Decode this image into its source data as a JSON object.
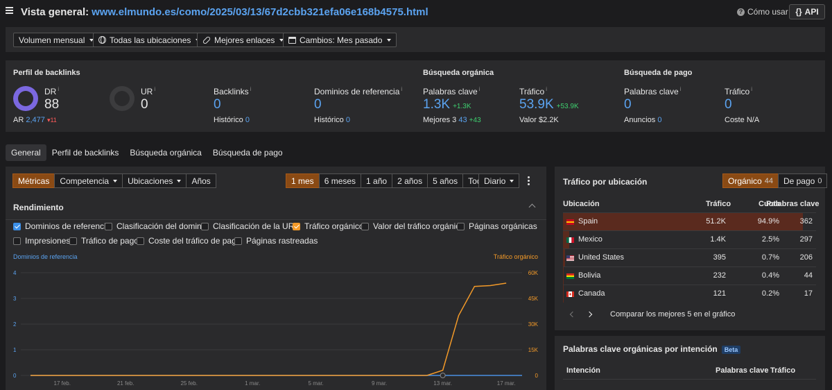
{
  "header": {
    "title": "Vista general:",
    "url": "www.elmundo.es/como/2025/03/13/67d2cbb321efa06e168b4575.html",
    "howto_label": "Cómo usar",
    "api_label": "API"
  },
  "filters": {
    "volume": "Volumen mensual",
    "locations": "Todas las ubicaciones",
    "links": "Mejores enlaces",
    "changes": "Cambios: Mes pasado"
  },
  "metrics": {
    "backlink_profile_title": "Perfil de backlinks",
    "organic_title": "Búsqueda orgánica",
    "paid_title": "Búsqueda de pago",
    "dr": {
      "label": "DR",
      "value": "88",
      "ar_label": "AR",
      "ar_value": "2,477",
      "ar_delta": "▾11"
    },
    "ur": {
      "label": "UR",
      "value": "0"
    },
    "backlinks": {
      "label": "Backlinks",
      "value": "0",
      "history_label": "Histórico",
      "history_value": "0"
    },
    "ref_domains": {
      "label": "Dominios de referencia",
      "value": "0",
      "history_label": "Histórico",
      "history_value": "0"
    },
    "organic_keywords": {
      "label": "Palabras clave",
      "value": "1.3K",
      "delta": "+1.3K",
      "top3_label": "Mejores 3",
      "top3_value": "43",
      "top3_delta": "+43"
    },
    "organic_traffic": {
      "label": "Tráfico",
      "value": "53.9K",
      "delta": "+53.9K",
      "value_label": "Valor",
      "value_amount": "$2.2K"
    },
    "paid_keywords": {
      "label": "Palabras clave",
      "value": "0",
      "ads_label": "Anuncios",
      "ads_value": "0"
    },
    "paid_traffic": {
      "label": "Tráfico",
      "value": "0",
      "cost_label": "Coste",
      "cost_value": "N/A"
    }
  },
  "tabs": [
    "General",
    "Perfil de backlinks",
    "Búsqueda orgánica",
    "Búsqueda de pago"
  ],
  "chart_controls": {
    "view_tabs": [
      "Métricas",
      "Competencia",
      "Ubicaciones",
      "Años"
    ],
    "ranges": [
      "1 mes",
      "6 meses",
      "1 año",
      "2 años",
      "5 años",
      "Todo"
    ],
    "granularity": "Diario"
  },
  "performance": {
    "title": "Rendimiento",
    "checkboxes": [
      {
        "label": "Dominios de referencia",
        "checked": true
      },
      {
        "label": "Clasificación del dominio",
        "checked": false
      },
      {
        "label": "Clasificación de la URL",
        "checked": false
      },
      {
        "label": "Tráfico orgánico",
        "checked": true
      },
      {
        "label": "Valor del tráfico orgánico",
        "checked": false
      },
      {
        "label": "Páginas orgánicas",
        "checked": false
      },
      {
        "label": "Impresiones",
        "checked": false
      },
      {
        "label": "Tráfico de pago",
        "checked": false
      },
      {
        "label": "Coste del tráfico de pago",
        "checked": false
      },
      {
        "label": "Páginas rastreadas",
        "checked": false
      }
    ]
  },
  "chart_data": {
    "type": "line",
    "x": [
      "15 feb.",
      "16 feb.",
      "17 feb.",
      "18 feb.",
      "19 feb.",
      "20 feb.",
      "21 feb.",
      "22 feb.",
      "23 feb.",
      "24 feb.",
      "25 feb.",
      "26 feb.",
      "27 feb.",
      "28 feb.",
      "1 mar.",
      "2 mar.",
      "3 mar.",
      "4 mar.",
      "5 mar.",
      "6 mar.",
      "7 mar.",
      "8 mar.",
      "9 mar.",
      "10 mar.",
      "11 mar.",
      "12 mar.",
      "13 mar.",
      "14 mar.",
      "15 mar.",
      "16 mar.",
      "17 mar.",
      "18 mar."
    ],
    "xticks": [
      "17 feb.",
      "21 feb.",
      "25 feb.",
      "1 mar.",
      "5 mar.",
      "9 mar.",
      "13 mar.",
      "17 mar."
    ],
    "series": [
      {
        "name": "Dominios de referencia",
        "axis": "left",
        "color": "#4a90e2",
        "values": [
          0,
          0,
          0,
          0,
          0,
          0,
          0,
          0,
          0,
          0,
          0,
          0,
          0,
          0,
          0,
          0,
          0,
          0,
          0,
          0,
          0,
          0,
          0,
          0,
          0,
          0,
          0,
          0,
          0,
          0,
          0,
          0
        ]
      },
      {
        "name": "Tráfico orgánico",
        "axis": "right",
        "color": "#f39a29",
        "values": [
          0,
          0,
          0,
          0,
          0,
          0,
          0,
          0,
          0,
          0,
          0,
          0,
          0,
          0,
          0,
          0,
          0,
          0,
          0,
          0,
          0,
          0,
          0,
          0,
          0,
          0,
          3000,
          35000,
          52000,
          52500,
          53900,
          null
        ]
      }
    ],
    "ylabel_left": "Dominios de referencia",
    "ylabel_right": "Tráfico orgánico",
    "yticks_left": [
      "0",
      "1",
      "2",
      "3",
      "4"
    ],
    "yticks_right": [
      "0",
      "15K",
      "30K",
      "45K",
      "60K"
    ],
    "ylim_left": [
      0,
      4
    ],
    "ylim_right": [
      0,
      60000
    ]
  },
  "traffic_by_location": {
    "title": "Tráfico por ubicación",
    "toggle": [
      {
        "label": "Orgánico",
        "count": "44",
        "active": true
      },
      {
        "label": "De pago",
        "count": "0",
        "active": false
      }
    ],
    "columns": [
      "Ubicación",
      "Tráfico",
      "Cuota",
      "Palabras clave"
    ],
    "rows": [
      {
        "country": "Spain",
        "traffic": "51.2K",
        "share": "94.9%",
        "share_value": 94.9,
        "keywords": "362"
      },
      {
        "country": "Mexico",
        "traffic": "1.4K",
        "share": "2.5%",
        "share_value": 2.5,
        "keywords": "297"
      },
      {
        "country": "United States",
        "traffic": "395",
        "share": "0.7%",
        "share_value": 0.7,
        "keywords": "206"
      },
      {
        "country": "Bolivia",
        "traffic": "232",
        "share": "0.4%",
        "share_value": 0.4,
        "keywords": "44"
      },
      {
        "country": "Canada",
        "traffic": "121",
        "share": "0.2%",
        "share_value": 0.2,
        "keywords": "17"
      }
    ],
    "compare_label": "Comparar los mejores 5 en el gráfico"
  },
  "intent": {
    "title": "Palabras clave orgánicas por intención",
    "badge": "Beta",
    "columns": [
      "Intención",
      "Palabras clave",
      "Tráfico"
    ]
  }
}
